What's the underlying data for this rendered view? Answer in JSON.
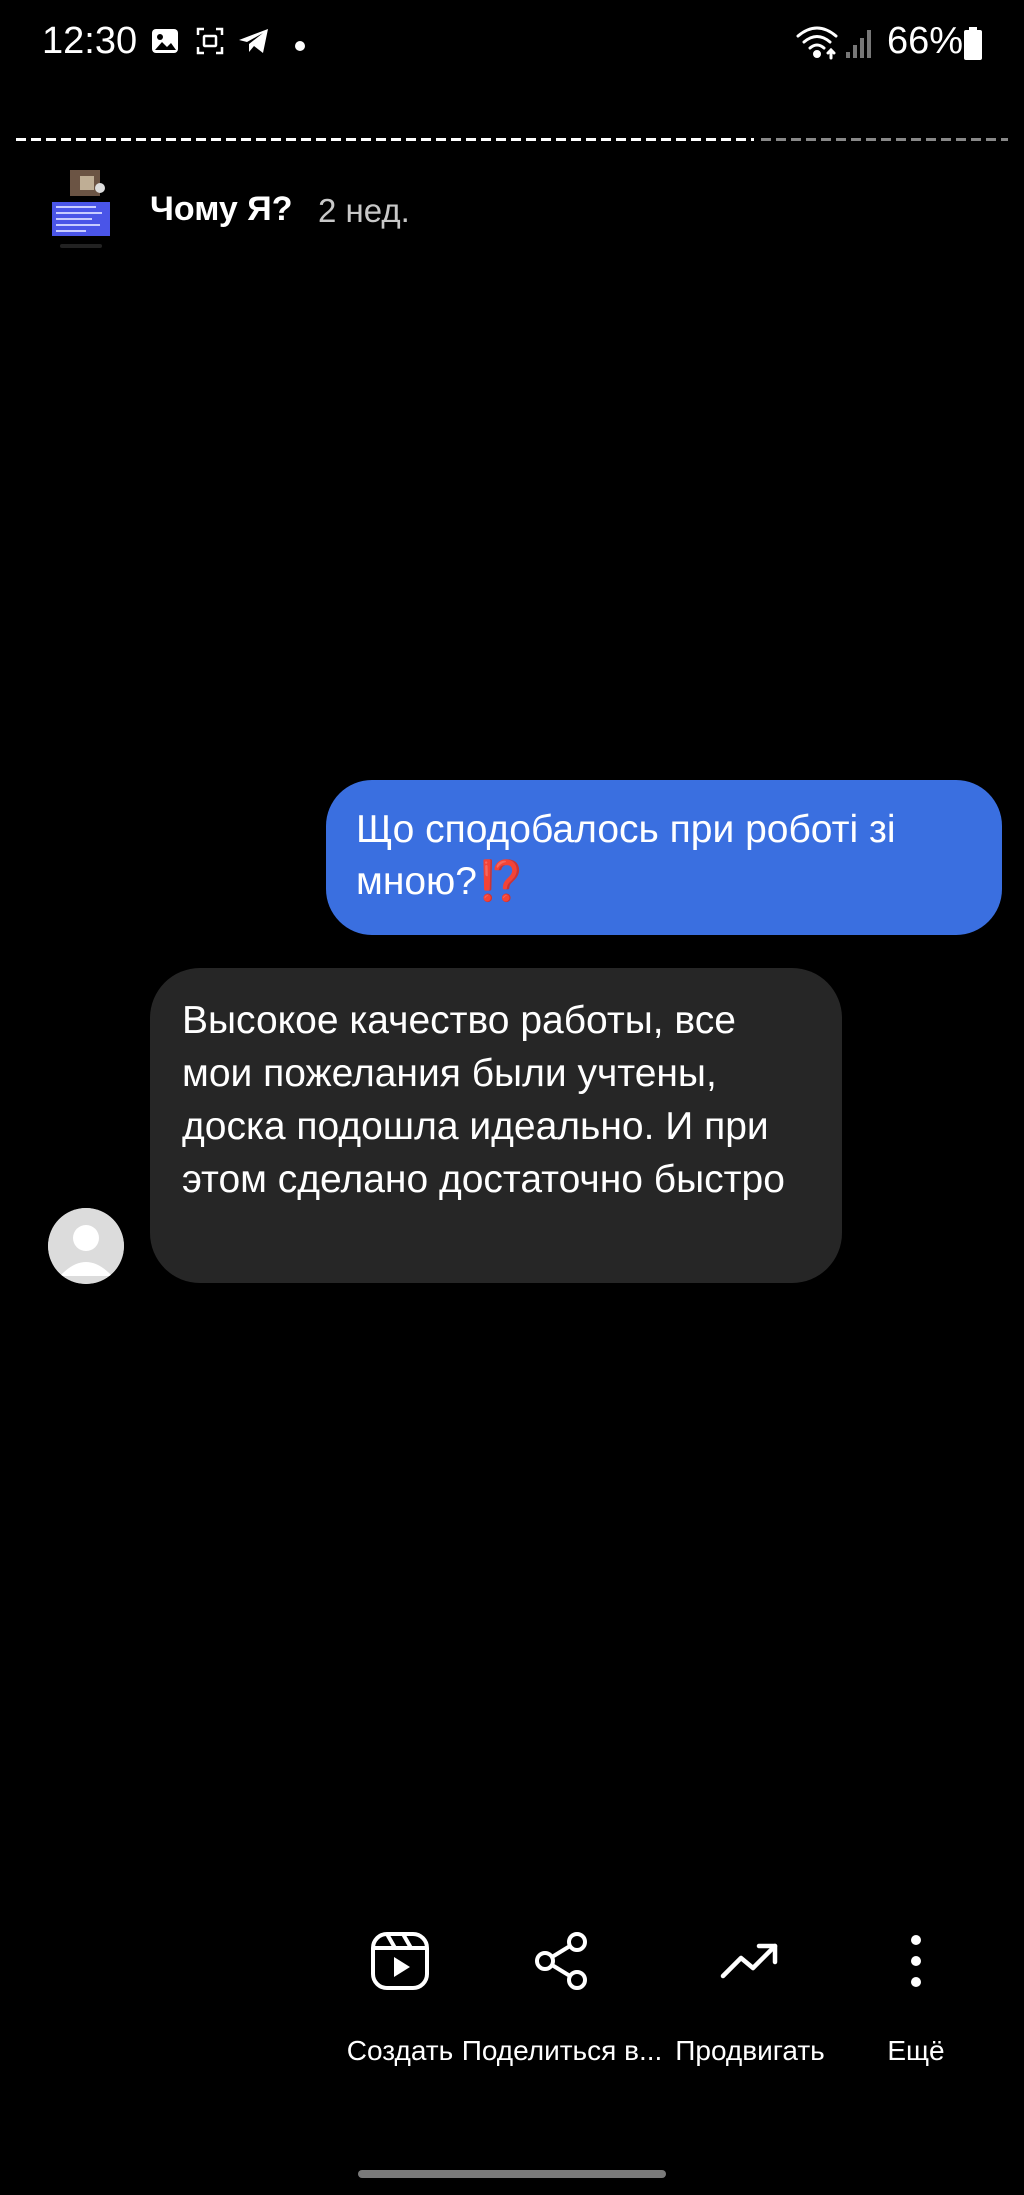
{
  "status_bar": {
    "time": "12:30",
    "battery_percent": "66%",
    "icons": [
      "gallery-icon",
      "screenshot-icon",
      "telegram-icon",
      "notification-dot-icon",
      "wifi-icon",
      "signal-icon",
      "battery-icon"
    ]
  },
  "story": {
    "title": "Чому Я?",
    "age": "2 нед."
  },
  "messages": {
    "outgoing": {
      "text": "Що сподобалось при роботі зі мною?",
      "emoji": "⁉️"
    },
    "incoming": {
      "text": "Высокое качество работы, все мои пожелания были учтены, доска подошла идеально. И при этом сделано достаточно быстро"
    }
  },
  "actions": [
    {
      "label": "Создать",
      "icon": "reels-create-icon"
    },
    {
      "label": "Поделиться в...",
      "icon": "share-icon"
    },
    {
      "label": "Продвигать",
      "icon": "trending-up-icon"
    },
    {
      "label": "Ещё",
      "icon": "more-vertical-icon"
    }
  ],
  "colors": {
    "background": "#000000",
    "outgoing_bubble": "#3a6fe0",
    "incoming_bubble": "#262626",
    "accent_mark": "#d6001c"
  }
}
